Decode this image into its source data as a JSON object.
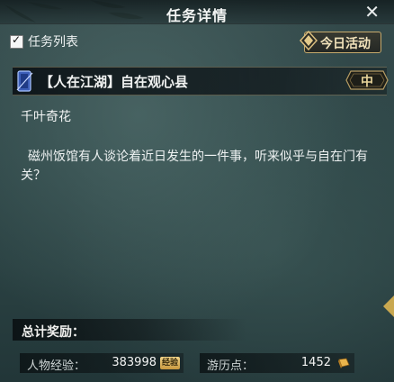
{
  "header": {
    "title": "任务详情",
    "close_icon": "close-icon"
  },
  "task_list": {
    "label": "任务列表",
    "checked": true
  },
  "today_button": {
    "label": "今日活动",
    "icon": "lantern-emblem-icon"
  },
  "task": {
    "name": "【人在江湖】自在观心县",
    "difficulty": "中",
    "icon": "scroll-quest-icon"
  },
  "content": {
    "subtitle": "千叶奇花",
    "description": "磁州饭馆有人谈论着近日发生的一件事，听来似乎与自在门有关？"
  },
  "rewards": {
    "header": "总计奖励：",
    "items": [
      {
        "label": "人物经验：",
        "value": "383998",
        "icon_text": "经验"
      },
      {
        "label": "游历点：",
        "value": "1452",
        "icon": "gold-ingot-icon"
      }
    ]
  },
  "colors": {
    "accent_gold": "#c7ab6d",
    "badge_text": "#e8d49a"
  }
}
